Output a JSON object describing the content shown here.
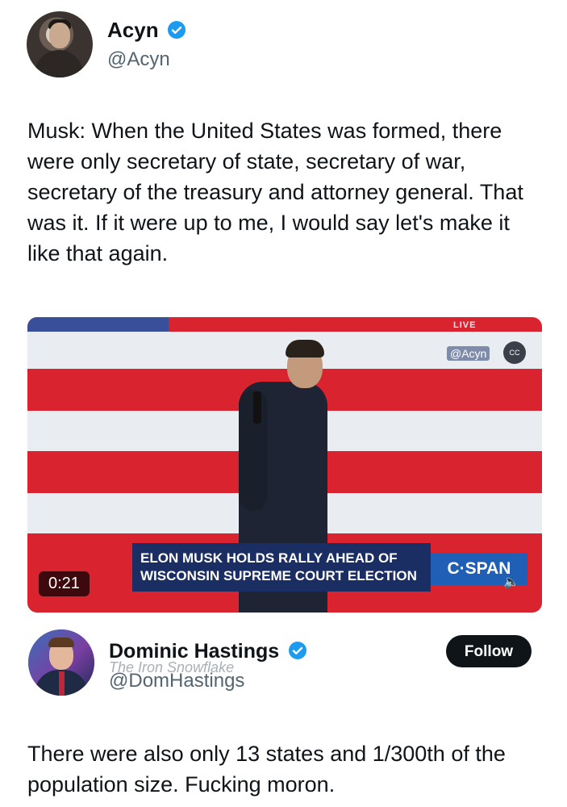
{
  "tweet1": {
    "author_name": "Acyn",
    "author_handle": "@Acyn",
    "text": "Musk: When the United States was formed, there were only secretary of state, secretary of war, secretary of the treasury and attorney general. That was it. If it were up to me, I would say let's make it like that again."
  },
  "video": {
    "live_badge": "LIVE",
    "watermark": "@Acyn",
    "cc_label": "CC",
    "chyron_line1": "ELON MUSK HOLDS RALLY AHEAD OF",
    "chyron_line2": "WISCONSIN SUPREME COURT ELECTION",
    "network_logo": "C·SPAN",
    "duration": "0:21",
    "mute_icon": "🔈",
    "colors": {
      "red_stripe": "#d9232e",
      "white_stripe": "#e9edf2",
      "blue_canton": "#3a4f9a"
    }
  },
  "tweet2": {
    "author_name": "Dominic Hastings",
    "author_handle": "@DomHastings",
    "overlay_watermark": "The Iron Snowflake",
    "follow_label": "Follow",
    "text": "There were also only 13 states and 1/300th of the population size. Fucking moron."
  },
  "colors": {
    "verified_blue": "#1d9bf0",
    "text": "#0f1419",
    "muted": "#536471"
  }
}
